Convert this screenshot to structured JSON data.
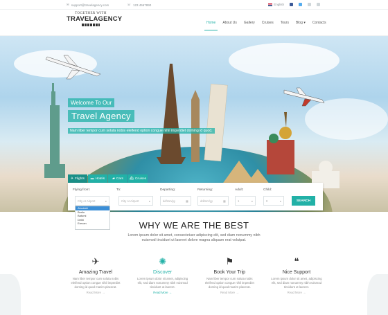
{
  "topbar": {
    "email": "support@travelagency.com",
    "phone": "123 4567890",
    "language": "English"
  },
  "logo": {
    "small": "TOGETHER WITH",
    "big": "TRAVELAGENCY"
  },
  "nav": [
    "Home",
    "About Us",
    "Gallery",
    "Cruises",
    "Tours",
    "Blog ▾",
    "Contacts"
  ],
  "hero": {
    "subtitle": "Welcome To Our",
    "title": "Travel Agency",
    "description": "Nam liber tempor cum soluta nobis eleifend option congue nihil imperdiet doming id quod."
  },
  "search": {
    "tabs": [
      "Flights",
      "Hotels",
      "Cars",
      "Cruises"
    ],
    "labels": {
      "flying_from": "Flying from:",
      "to": "To:",
      "departing": "Departing:",
      "returning": "Returning:",
      "adult": "Adult:",
      "child": "Child:"
    },
    "fields": {
      "from_placeholder": "City or Airport",
      "to_placeholder": "City or Airport",
      "departing_value": "dd/mm/yy",
      "returning_value": "dd/mm/yy",
      "adult_value": "1",
      "child_value": "0"
    },
    "button": "SEARCH",
    "dropdown_options": [
      "Abudabi",
      "Berlin",
      "Batumi",
      "Delhi",
      "Erevan"
    ]
  },
  "why": {
    "heading": "WHY WE ARE THE BEST",
    "text": "Lorem ipsum dolor sit amet, consectetuer adipiscing elit, sed diam nonummy nibh euismod tincidunt ut laoreet dolore magna aliquam erat volutpat."
  },
  "features": [
    {
      "title": "Amazing Travel",
      "text": "Nam liber tempor cum soluta nobis eleifend option congue nihil imperdiet doming id quod mazim placerat.",
      "more": "Read More →"
    },
    {
      "title": "Discover",
      "text": "Lorem ipsum dolor sit amet, adipiscing elit, sed diam nonummy nibh euismod tincidunt ut laoreet.",
      "more": "Read More →"
    },
    {
      "title": "Book Your Trip",
      "text": "Nam liber tempor cum soluta nobis eleifend option congue nihil imperdiet doming id quod mazim placerat.",
      "more": "Read More →"
    },
    {
      "title": "Nice Support",
      "text": "Lorem ipsum dolor sit amet, adipiscing elit, sed diam nonummy nibh euismod tincidunt ut laoreet.",
      "more": "Read More →"
    }
  ],
  "colors": {
    "accent": "#22b1a7"
  }
}
